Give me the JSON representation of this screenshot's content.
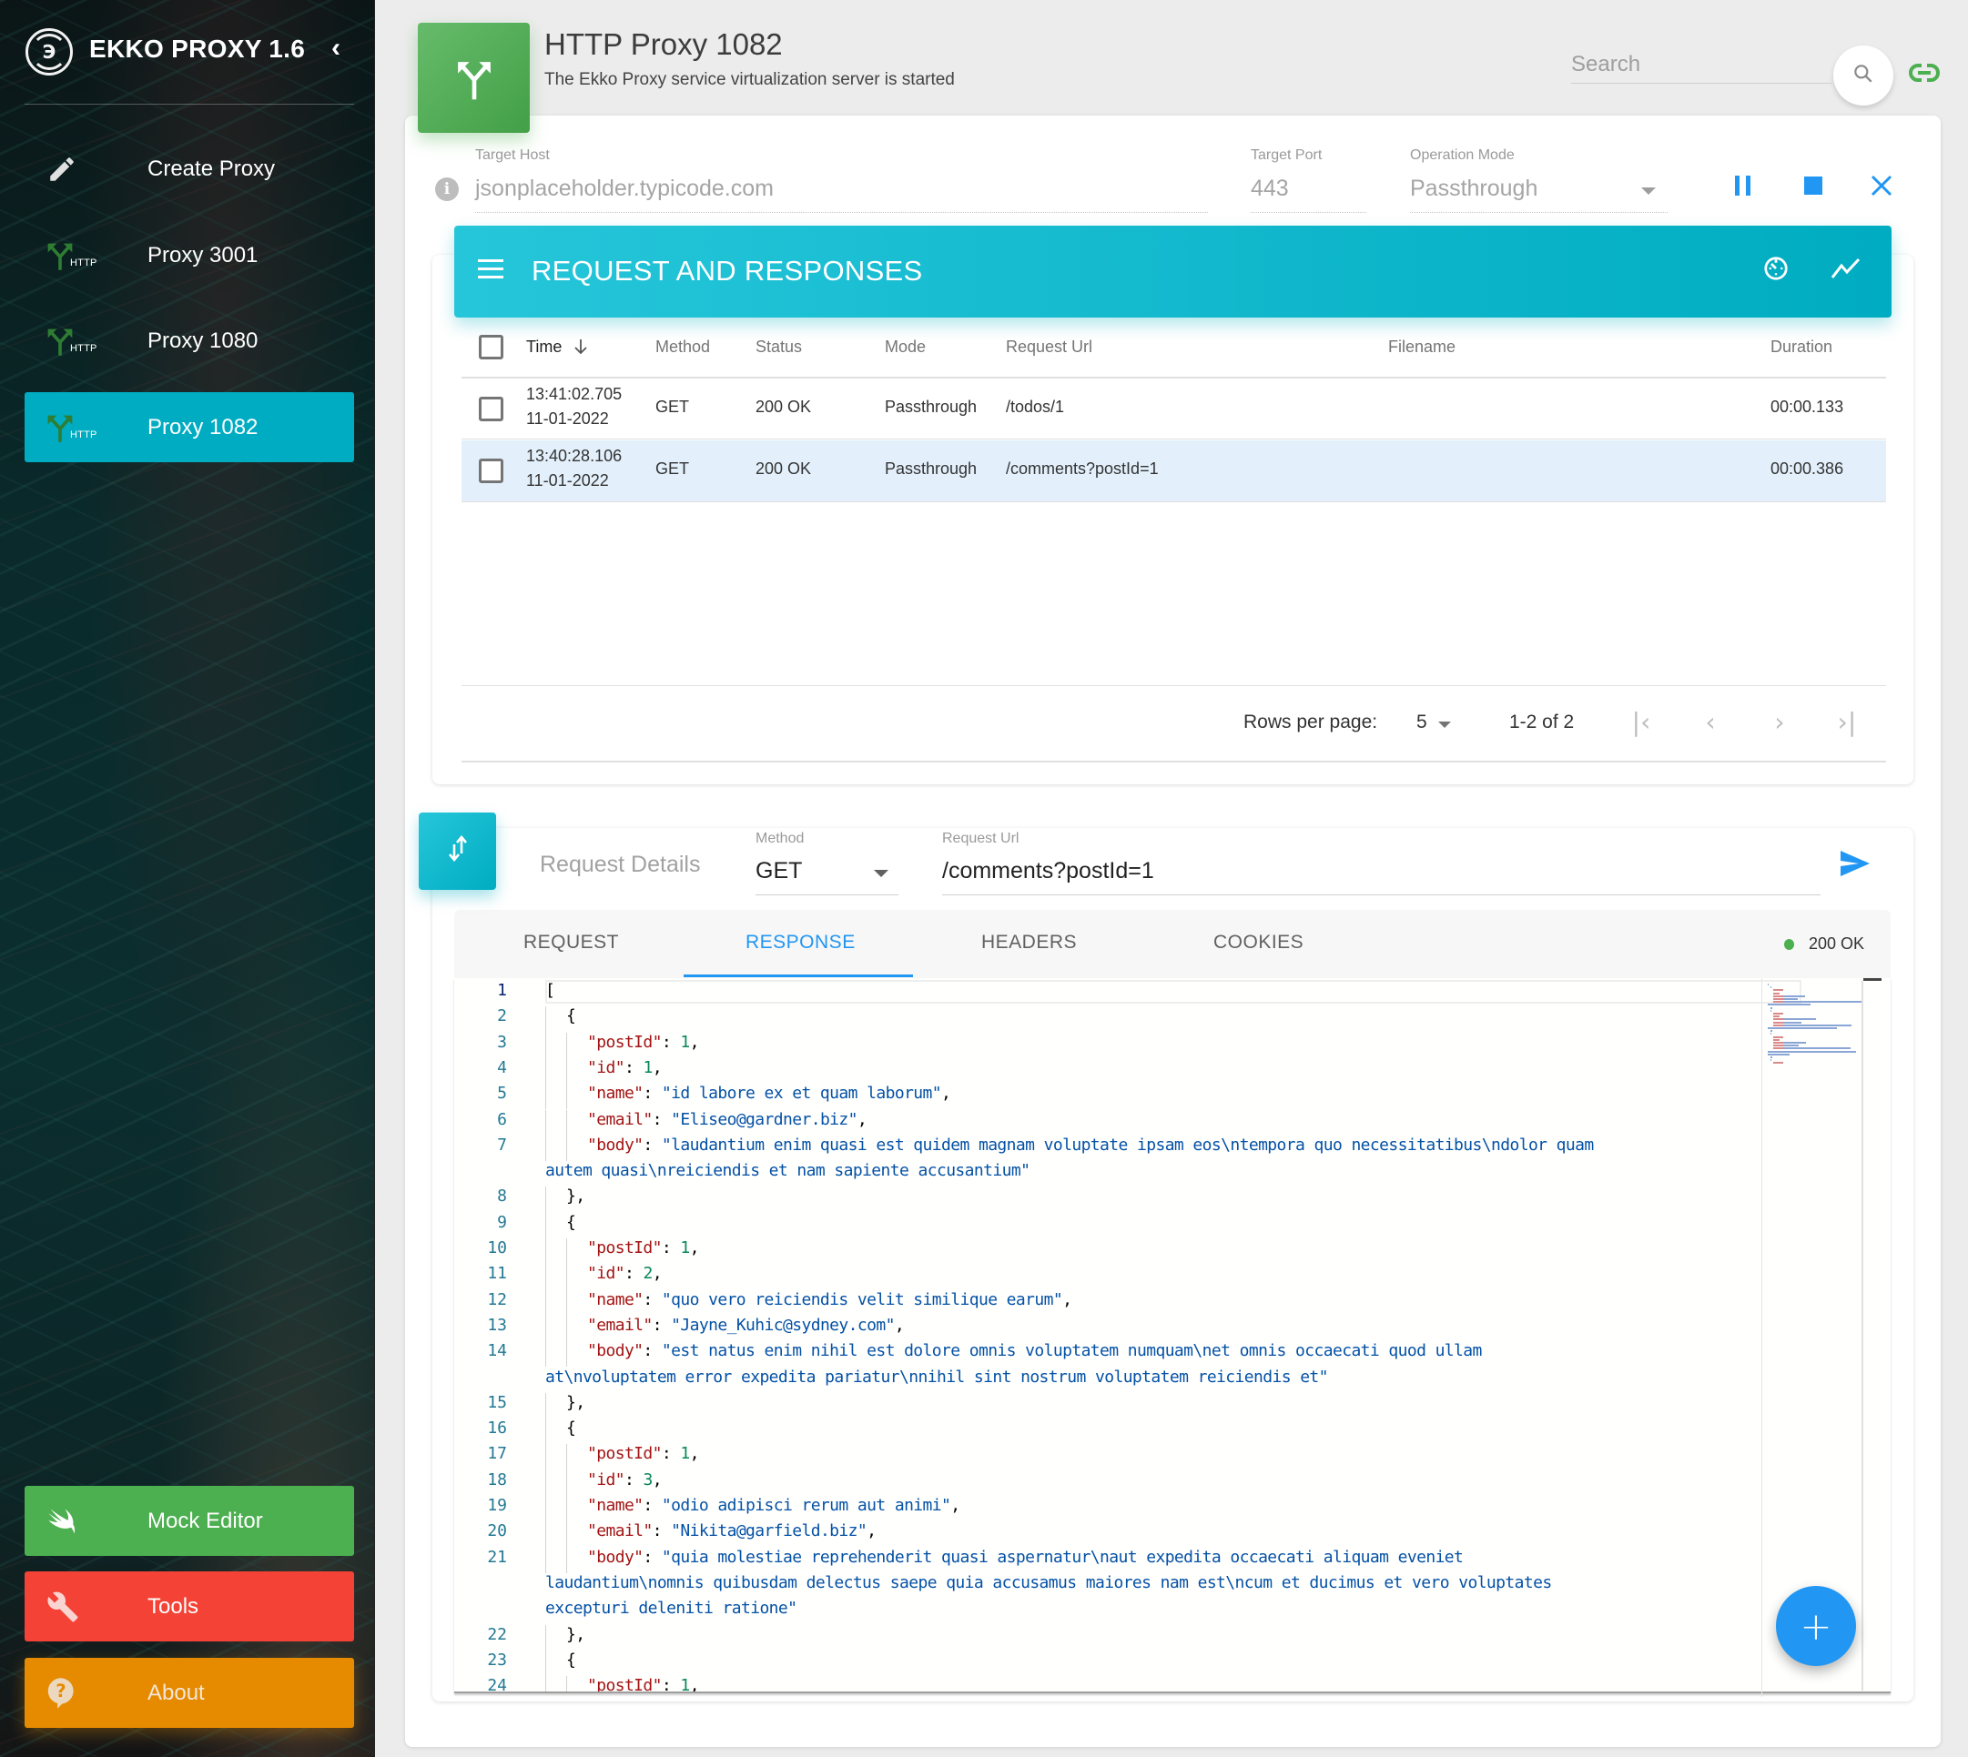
{
  "app": {
    "title": "EKKO PROXY 1.6",
    "collapse_icon": "chevron-left-icon"
  },
  "sidebar": {
    "items": [
      {
        "label": "Create Proxy",
        "icon": "pencil-icon",
        "active": false
      },
      {
        "label": "Proxy 3001",
        "icon": "http-split-icon",
        "tag": "HTTP",
        "active": false
      },
      {
        "label": "Proxy 1080",
        "icon": "http-split-icon",
        "tag": "HTTP",
        "active": false
      },
      {
        "label": "Proxy 1082",
        "icon": "http-split-icon",
        "tag": "HTTP",
        "active": true
      }
    ],
    "bottom": [
      {
        "label": "Mock Editor",
        "icon": "swift-bird-icon",
        "color": "#4caf50"
      },
      {
        "label": "Tools",
        "icon": "wrench-icon",
        "color": "#f44336"
      },
      {
        "label": "About",
        "icon": "help-bubble-icon",
        "color": "#e68a00"
      }
    ],
    "active_color": "#00acc1"
  },
  "header": {
    "title": "HTTP Proxy 1082",
    "subtitle": "The Ekko Proxy service virtualization server is started",
    "search_placeholder": "Search",
    "search_value": ""
  },
  "proxy_config": {
    "target_host_label": "Target Host",
    "target_host": "jsonplaceholder.typicode.com",
    "target_port_label": "Target Port",
    "target_port": "443",
    "operation_mode_label": "Operation Mode",
    "operation_mode": "Passthrough",
    "controls": [
      "pause",
      "stop",
      "close"
    ],
    "control_color": "#2196f3"
  },
  "requests_panel": {
    "title": "REQUEST AND RESPONSES",
    "columns": [
      "Time",
      "Method",
      "Status",
      "Mode",
      "Request Url",
      "Filename",
      "Duration"
    ],
    "sort_column": "Time",
    "sort_direction": "desc",
    "rows": [
      {
        "time": "13:41:02.705",
        "date": "11-01-2022",
        "method": "GET",
        "status": "200 OK",
        "mode": "Passthrough",
        "url": "/todos/1",
        "filename": "",
        "duration": "00:00.133",
        "selected": false
      },
      {
        "time": "13:40:28.106",
        "date": "11-01-2022",
        "method": "GET",
        "status": "200 OK",
        "mode": "Passthrough",
        "url": "/comments?postId=1",
        "filename": "",
        "duration": "00:00.386",
        "selected": true
      }
    ],
    "pagination": {
      "rows_per_page_label": "Rows per page:",
      "rows_per_page": "5",
      "range": "1-2 of 2"
    }
  },
  "request_details": {
    "title": "Request Details",
    "method_label": "Method",
    "method": "GET",
    "url_label": "Request Url",
    "url": "/comments?postId=1",
    "tabs": [
      "REQUEST",
      "RESPONSE",
      "HEADERS",
      "COOKIES"
    ],
    "active_tab": "RESPONSE",
    "status": "200 OK",
    "status_color": "#4caf50"
  },
  "editor": {
    "lines": [
      {
        "n": "1",
        "indent": 0,
        "parts": [
          [
            "p",
            "["
          ]
        ]
      },
      {
        "n": "2",
        "indent": 1,
        "parts": [
          [
            "p",
            "{"
          ]
        ]
      },
      {
        "n": "3",
        "indent": 2,
        "parts": [
          [
            "k",
            "\"postId\""
          ],
          [
            "p",
            ": "
          ],
          [
            "n",
            "1"
          ],
          [
            "p",
            ","
          ]
        ]
      },
      {
        "n": "4",
        "indent": 2,
        "parts": [
          [
            "k",
            "\"id\""
          ],
          [
            "p",
            ": "
          ],
          [
            "n",
            "1"
          ],
          [
            "p",
            ","
          ]
        ]
      },
      {
        "n": "5",
        "indent": 2,
        "parts": [
          [
            "k",
            "\"name\""
          ],
          [
            "p",
            ": "
          ],
          [
            "s",
            "\"id labore ex et quam laborum\""
          ],
          [
            "p",
            ","
          ]
        ]
      },
      {
        "n": "6",
        "indent": 2,
        "parts": [
          [
            "k",
            "\"email\""
          ],
          [
            "p",
            ": "
          ],
          [
            "s",
            "\"Eliseo@gardner.biz\""
          ],
          [
            "p",
            ","
          ]
        ]
      },
      {
        "n": "7",
        "indent": 2,
        "parts": [
          [
            "k",
            "\"body\""
          ],
          [
            "p",
            ": "
          ],
          [
            "s",
            "\"laudantium enim quasi est quidem magnam voluptate ipsam eos\\ntempora quo necessitatibus\\ndolor quam"
          ]
        ]
      },
      {
        "n": "",
        "indent": 0,
        "parts": [
          [
            "s",
            "autem quasi\\nreiciendis et nam sapiente accusantium\""
          ]
        ]
      },
      {
        "n": "8",
        "indent": 1,
        "parts": [
          [
            "p",
            "},"
          ]
        ]
      },
      {
        "n": "9",
        "indent": 1,
        "parts": [
          [
            "p",
            "{"
          ]
        ]
      },
      {
        "n": "10",
        "indent": 2,
        "parts": [
          [
            "k",
            "\"postId\""
          ],
          [
            "p",
            ": "
          ],
          [
            "n",
            "1"
          ],
          [
            "p",
            ","
          ]
        ]
      },
      {
        "n": "11",
        "indent": 2,
        "parts": [
          [
            "k",
            "\"id\""
          ],
          [
            "p",
            ": "
          ],
          [
            "n",
            "2"
          ],
          [
            "p",
            ","
          ]
        ]
      },
      {
        "n": "12",
        "indent": 2,
        "parts": [
          [
            "k",
            "\"name\""
          ],
          [
            "p",
            ": "
          ],
          [
            "s",
            "\"quo vero reiciendis velit similique earum\""
          ],
          [
            "p",
            ","
          ]
        ]
      },
      {
        "n": "13",
        "indent": 2,
        "parts": [
          [
            "k",
            "\"email\""
          ],
          [
            "p",
            ": "
          ],
          [
            "s",
            "\"Jayne_Kuhic@sydney.com\""
          ],
          [
            "p",
            ","
          ]
        ]
      },
      {
        "n": "14",
        "indent": 2,
        "parts": [
          [
            "k",
            "\"body\""
          ],
          [
            "p",
            ": "
          ],
          [
            "s",
            "\"est natus enim nihil est dolore omnis voluptatem numquam\\net omnis occaecati quod ullam"
          ]
        ]
      },
      {
        "n": "",
        "indent": 0,
        "parts": [
          [
            "s",
            "at\\nvoluptatem error expedita pariatur\\nnihil sint nostrum voluptatem reiciendis et\""
          ]
        ]
      },
      {
        "n": "15",
        "indent": 1,
        "parts": [
          [
            "p",
            "},"
          ]
        ]
      },
      {
        "n": "16",
        "indent": 1,
        "parts": [
          [
            "p",
            "{"
          ]
        ]
      },
      {
        "n": "17",
        "indent": 2,
        "parts": [
          [
            "k",
            "\"postId\""
          ],
          [
            "p",
            ": "
          ],
          [
            "n",
            "1"
          ],
          [
            "p",
            ","
          ]
        ]
      },
      {
        "n": "18",
        "indent": 2,
        "parts": [
          [
            "k",
            "\"id\""
          ],
          [
            "p",
            ": "
          ],
          [
            "n",
            "3"
          ],
          [
            "p",
            ","
          ]
        ]
      },
      {
        "n": "19",
        "indent": 2,
        "parts": [
          [
            "k",
            "\"name\""
          ],
          [
            "p",
            ": "
          ],
          [
            "s",
            "\"odio adipisci rerum aut animi\""
          ],
          [
            "p",
            ","
          ]
        ]
      },
      {
        "n": "20",
        "indent": 2,
        "parts": [
          [
            "k",
            "\"email\""
          ],
          [
            "p",
            ": "
          ],
          [
            "s",
            "\"Nikita@garfield.biz\""
          ],
          [
            "p",
            ","
          ]
        ]
      },
      {
        "n": "21",
        "indent": 2,
        "parts": [
          [
            "k",
            "\"body\""
          ],
          [
            "p",
            ": "
          ],
          [
            "s",
            "\"quia molestiae reprehenderit quasi aspernatur\\naut expedita occaecati aliquam eveniet"
          ]
        ]
      },
      {
        "n": "",
        "indent": 0,
        "parts": [
          [
            "s",
            "laudantium\\nomnis quibusdam delectus saepe quia accusamus maiores nam est\\ncum et ducimus et vero voluptates"
          ]
        ]
      },
      {
        "n": "",
        "indent": 0,
        "parts": [
          [
            "s",
            "excepturi deleniti ratione\""
          ]
        ]
      },
      {
        "n": "22",
        "indent": 1,
        "parts": [
          [
            "p",
            "},"
          ]
        ]
      },
      {
        "n": "23",
        "indent": 1,
        "parts": [
          [
            "p",
            "{"
          ]
        ]
      },
      {
        "n": "24",
        "indent": 2,
        "parts": [
          [
            "k",
            "\"postId\""
          ],
          [
            "p",
            ": "
          ],
          [
            "n",
            "1"
          ],
          [
            "p",
            ","
          ]
        ]
      }
    ],
    "current_line": "1"
  },
  "fab": {
    "label": "+",
    "icon": "plus-icon"
  }
}
